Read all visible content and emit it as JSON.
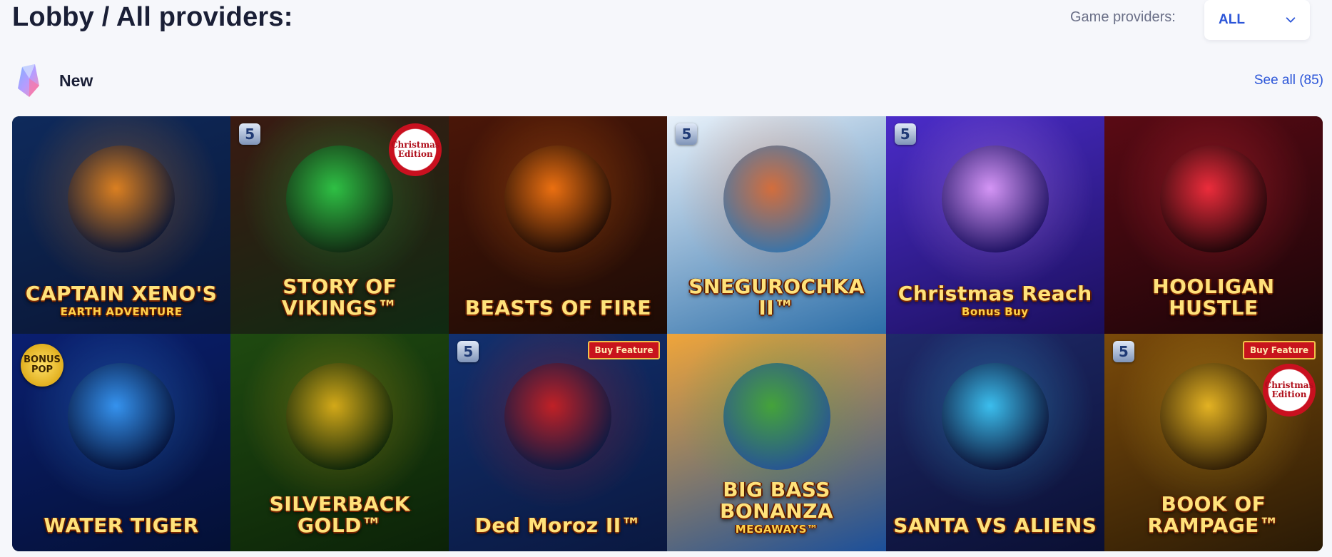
{
  "header": {
    "title": "Lobby / All providers:",
    "providers_label": "Game providers:",
    "providers_value": "ALL"
  },
  "section": {
    "title": "New",
    "see_all": "See all (85)"
  },
  "games": [
    {
      "name": "CAPTAIN XENO'S",
      "subtitle": "EARTH ADVENTURE",
      "bg": [
        "#0e2a5c",
        "#0a1533"
      ],
      "accent": "#f28a1c",
      "badges": []
    },
    {
      "name": "STORY OF VIKINGS™",
      "subtitle": "",
      "bg": [
        "#3a1a12",
        "#0f2a12"
      ],
      "accent": "#2fd24a",
      "badges": [
        "s",
        "edition"
      ]
    },
    {
      "name": "BEASTS OF FIRE",
      "subtitle": "",
      "bg": [
        "#4a1608",
        "#1c0b05"
      ],
      "accent": "#ff7a12",
      "badges": []
    },
    {
      "name": "SNEGUROCHKA II™",
      "subtitle": "",
      "bg": [
        "#e8f1fa",
        "#2c6ea8"
      ],
      "accent": "#d9642a",
      "badges": [
        "s"
      ]
    },
    {
      "name": "Christmas Reach",
      "subtitle": "Bonus Buy",
      "bg": [
        "#4b2cc9",
        "#1a0f5c"
      ],
      "accent": "#e6a2ff",
      "badges": [
        "s"
      ]
    },
    {
      "name": "HOOLIGAN HUSTLE",
      "subtitle": "",
      "bg": [
        "#5a0a14",
        "#1a0508"
      ],
      "accent": "#ff3040",
      "badges": []
    },
    {
      "name": "WATER TIGER",
      "subtitle": "",
      "bg": [
        "#0a1f70",
        "#041035"
      ],
      "accent": "#3aa0ff",
      "badges": [
        "bonus"
      ]
    },
    {
      "name": "SILVERBACK GOLD™",
      "subtitle": "",
      "bg": [
        "#1f4a10",
        "#0b2208"
      ],
      "accent": "#e8b51a",
      "badges": []
    },
    {
      "name": "Ded Moroz II™",
      "subtitle": "",
      "bg": [
        "#12306e",
        "#0a1840"
      ],
      "accent": "#d42020",
      "badges": [
        "s",
        "buy"
      ]
    },
    {
      "name": "BIG BASS BONANZA",
      "subtitle": "MEGAWAYS™",
      "bg": [
        "#f0a53a",
        "#1b4f9a"
      ],
      "accent": "#3aa636",
      "badges": []
    },
    {
      "name": "SANTA VS ALIENS",
      "subtitle": "",
      "bg": [
        "#1f2a6a",
        "#0a0f33"
      ],
      "accent": "#3fd0ff",
      "badges": []
    },
    {
      "name": "BOOK OF RAMPAGE™",
      "subtitle": "",
      "bg": [
        "#7a4a0a",
        "#2a1a05"
      ],
      "accent": "#f2c026",
      "badges": [
        "s",
        "buy",
        "edition"
      ]
    }
  ],
  "badge_text": {
    "s": "5",
    "edition": "Christmas Edition",
    "buy": "Buy Feature",
    "bonus": "BONUS POP"
  },
  "colors": {
    "accent": "#2b55d8",
    "background": "#f6f7fb"
  }
}
